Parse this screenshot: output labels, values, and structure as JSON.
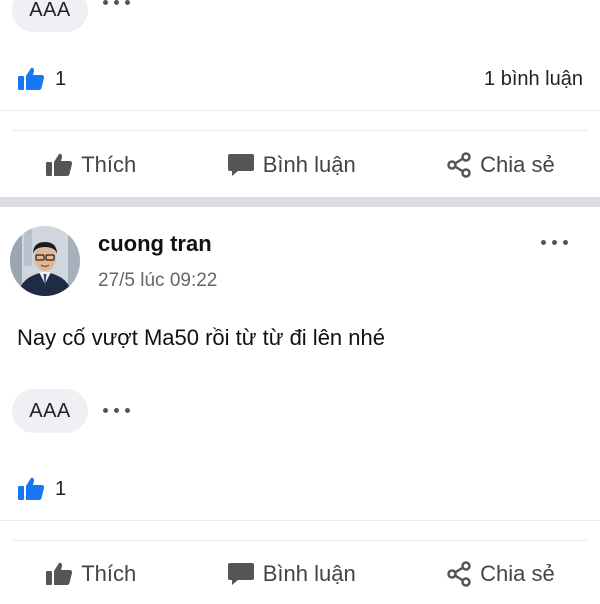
{
  "post1": {
    "tag_label": "AAA",
    "like_count": "1",
    "comment_count_text": "1 bình luận"
  },
  "actions": {
    "like": "Thích",
    "comment": "Bình luận",
    "share": "Chia sẻ"
  },
  "post2": {
    "author": "cuong tran",
    "timestamp": "27/5 lúc 09:22",
    "content": "Nay cố vượt Ma50 rồi từ từ đi lên nhé",
    "tag_label": "AAA",
    "like_count": "1"
  },
  "colors": {
    "like_blue": "#1877f2",
    "icon_gray": "#555555"
  },
  "icons": [
    "thumbs-up-icon",
    "comment-icon",
    "share-icon",
    "more-icon"
  ]
}
